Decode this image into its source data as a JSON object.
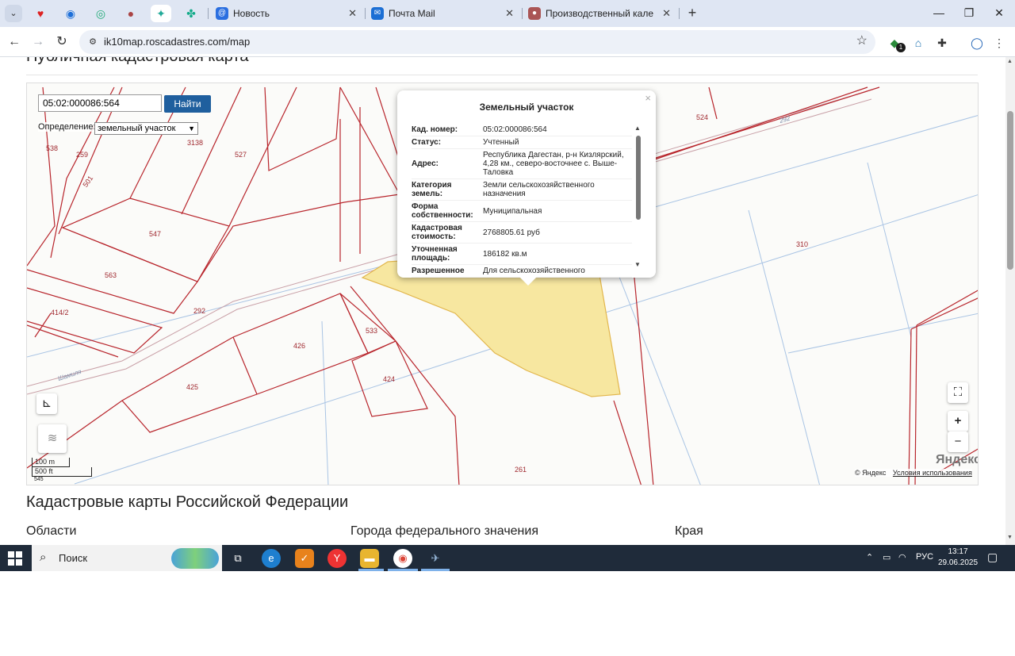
{
  "browser": {
    "tabs": [
      {
        "title": "Новость",
        "active": false
      },
      {
        "title": "Почта Mail",
        "active": false
      },
      {
        "title": "Производственный календарь",
        "active": false
      }
    ],
    "new_tab": "+",
    "url": "ik10map.roscadastres.com/map",
    "ext_badge": "1"
  },
  "page": {
    "heading": "Публичная кадастровая карта",
    "section_title": "Кадастровые карты Российской Федерации",
    "columns": [
      "Области",
      "Города федерального значения",
      "Края"
    ]
  },
  "map": {
    "search_value": "05:02:000086:564",
    "search_button": "Найти",
    "definition_label": "Определение:",
    "definition_value": "земельный участок",
    "scale_m": "100 m",
    "scale_ft": "500 ft",
    "scale_extra": "545",
    "copyright": "© Яндекс",
    "terms": "Условия использования",
    "logo": "Яндекс",
    "zoom_in": "+",
    "zoom_out": "−",
    "parcel_labels": [
      "538",
      "259",
      "3138",
      "527",
      "501",
      "547",
      "563",
      "414/2",
      "292",
      "533",
      "426",
      "424",
      "425",
      "261",
      "524",
      "310"
    ],
    "street_labels": [
      "Шамиля",
      "292"
    ],
    "highlight_color": "#f7e7a0"
  },
  "popup": {
    "title": "Земельный участок",
    "close": "×",
    "rows": [
      {
        "k": "Кад. номер:",
        "v": "05:02:000086:564"
      },
      {
        "k": "Статус:",
        "v": "Учтенный"
      },
      {
        "k": "Адрес:",
        "v": "Республика Дагестан, р-н Кизлярский, 4,28 км., северо-восточнее с. Выше-Таловка"
      },
      {
        "k": "Категория земель:",
        "v": "Земли сельскохозяйственного назначения"
      },
      {
        "k": "Форма собственности:",
        "v": "Муниципальная"
      },
      {
        "k": "Кадастровая стоимость:",
        "v": "2768805.61 руб"
      },
      {
        "k": "Уточненная площадь:",
        "v": "186182 кв.м"
      },
      {
        "k": "Разрешенное",
        "v": "Для сельскохозяйственного"
      }
    ]
  },
  "taskbar": {
    "search_placeholder": "Поиск",
    "lang": "РУС",
    "time": "13:17",
    "date": "29.06.2025"
  }
}
